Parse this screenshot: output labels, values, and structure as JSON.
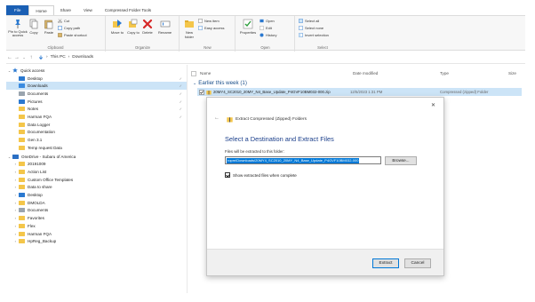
{
  "ribbon": {
    "tabs": [
      "File",
      "Home",
      "Share",
      "View",
      "Compressed Folder Tools"
    ],
    "clipboard": {
      "pin_label": "Pin to Quick access",
      "copy_label": "Copy",
      "paste_label": "Paste",
      "cut_label": "Cut",
      "copy_path_label": "Copy path",
      "paste_shortcut_label": "Paste shortcut",
      "group_label": "Clipboard"
    },
    "organize": {
      "move_label": "Move to",
      "copy_to_label": "Copy to",
      "delete_label": "Delete",
      "rename_label": "Rename",
      "group_label": "Organize"
    },
    "new": {
      "new_folder_label": "New folder",
      "new_item_label": "New item",
      "easy_access_label": "Easy access",
      "group_label": "New"
    },
    "open": {
      "properties_label": "Properties",
      "open_label": "Open",
      "edit_label": "Edit",
      "history_label": "History",
      "group_label": "Open"
    },
    "select": {
      "select_all_label": "Select all",
      "select_none_label": "Select none",
      "invert_label": "Invert selection",
      "group_label": "Select"
    }
  },
  "address": {
    "this_pc": "This PC",
    "downloads": "Downloads"
  },
  "nav": {
    "quick_access": "Quick access",
    "items": [
      {
        "label": "Desktop",
        "kind": "folder-blue",
        "pinned": true
      },
      {
        "label": "Downloads",
        "kind": "folder-dl",
        "pinned": true,
        "selected": true
      },
      {
        "label": "Documents",
        "kind": "folder-gray",
        "pinned": true
      },
      {
        "label": "Pictures",
        "kind": "folder-blue",
        "pinned": true
      },
      {
        "label": "Notes",
        "kind": "folder",
        "pinned": true
      },
      {
        "label": "Harman FQA",
        "kind": "folder",
        "pinned": true
      },
      {
        "label": "Data Logger",
        "kind": "folder",
        "pinned": false
      },
      {
        "label": "Documentation",
        "kind": "folder",
        "pinned": false
      },
      {
        "label": "Gen 3.1",
        "kind": "folder",
        "pinned": false
      },
      {
        "label": "Temp request Data",
        "kind": "folder",
        "pinned": false
      }
    ],
    "onedrive": "OneDrive - Subaru of America",
    "onedrive_items": [
      {
        "label": "20191009",
        "kind": "folder"
      },
      {
        "label": "Action List",
        "kind": "folder"
      },
      {
        "label": "Custom Office Templates",
        "kind": "folder"
      },
      {
        "label": "Data to share",
        "kind": "folder"
      },
      {
        "label": "Desktop",
        "kind": "folder-blue"
      },
      {
        "label": "DMOLDA",
        "kind": "folder"
      },
      {
        "label": "Documents",
        "kind": "folder-gray"
      },
      {
        "label": "Favorites",
        "kind": "folder"
      },
      {
        "label": "Flex",
        "kind": "folder"
      },
      {
        "label": "Harman FQA",
        "kind": "folder"
      },
      {
        "label": "HpReg_Backup",
        "kind": "folder"
      }
    ]
  },
  "content": {
    "col_name": "Name",
    "col_date": "Date modified",
    "col_type": "Type",
    "col_size": "Size",
    "group_label": "Earlier this week (1)",
    "file": {
      "name": "20MY4_SC2010_20MY_N4_Base_Update_P4GVF10BM032-000.zip",
      "date": "12/5/2023 1:31 PM",
      "type": "Compressed (zipped) Folder"
    }
  },
  "dialog": {
    "title": "Extract Compressed (Zipped) Folders",
    "heading": "Select a Destination and Extract Files",
    "field_label": "Files will be extracted to this folder:",
    "path_value": "ropm\\Downloads\\20MY4_SC2010_20MY_N4_Base_Update_P4GVF10BM032-000",
    "browse_label": "Browse...",
    "checkbox_label": "Show extracted files when complete",
    "checkbox_checked": true,
    "extract_label": "Extract",
    "cancel_label": "Cancel"
  }
}
